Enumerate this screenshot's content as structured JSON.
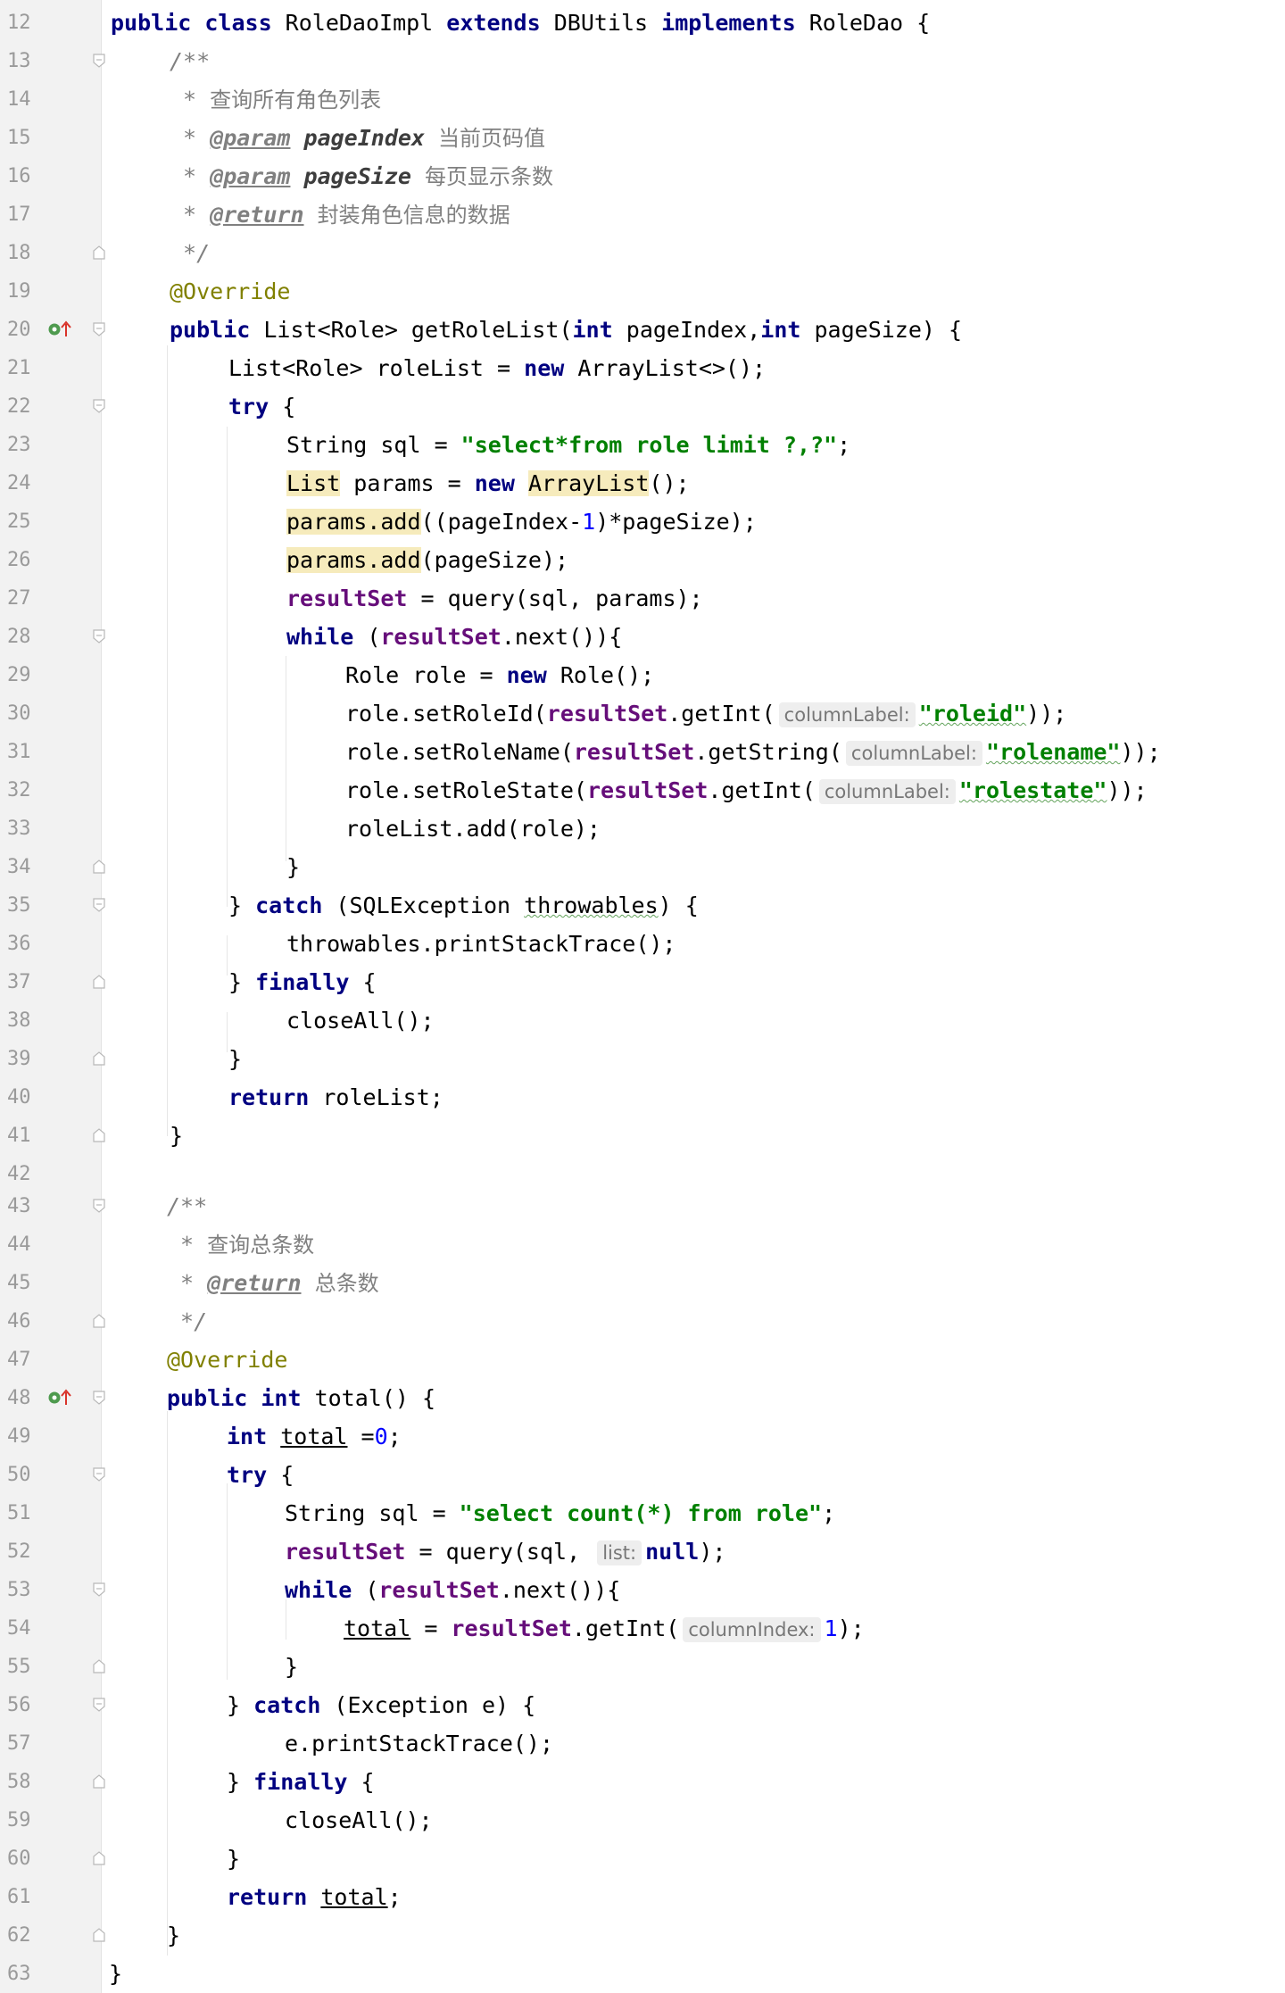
{
  "editor": {
    "theme_colors": {
      "keyword": "#000080",
      "string": "#008000",
      "comment": "#808080",
      "annotation": "#808000",
      "field": "#660e7a",
      "number": "#0000ff",
      "highlight": "#f6ebbc",
      "gutter_bg": "#f2f2f2",
      "line_number": "#9a9a9a"
    },
    "gutter_icons": {
      "20": "implementing-method-icon",
      "48": "implementing-method-icon"
    },
    "lines": {
      "l12": {
        "num": "12",
        "t1": "public class ",
        "t2": "RoleDaoImpl ",
        "t3": "extends ",
        "t4": "DBUtils ",
        "t5": "implements ",
        "t6": "RoleDao {"
      },
      "l13": {
        "num": "13",
        "t1": "/**"
      },
      "l14": {
        "num": "14",
        "t1": " * ",
        "t2": "查询所有角色列表"
      },
      "l15": {
        "num": "15",
        "t1": " * ",
        "t2": "@param",
        "t3": " pageIndex ",
        "t4": "当前页码值"
      },
      "l16": {
        "num": "16",
        "t1": " * ",
        "t2": "@param",
        "t3": " pageSize ",
        "t4": "每页显示条数"
      },
      "l17": {
        "num": "17",
        "t1": " * ",
        "t2": "@return",
        "t3": " ",
        "t4": "封装角色信息的数据"
      },
      "l18": {
        "num": "18",
        "t1": " */"
      },
      "l19": {
        "num": "19",
        "t1": "@Override"
      },
      "l20": {
        "num": "20",
        "t1": "public ",
        "t2": "List<Role> getRoleList(",
        "t3": "int ",
        "t4": "pageIndex,",
        "t5": "int ",
        "t6": "pageSize) {"
      },
      "l21": {
        "num": "21",
        "t1": "List<Role> roleList = ",
        "t2": "new ",
        "t3": "ArrayList<>();"
      },
      "l22": {
        "num": "22",
        "t1": "try ",
        "t2": "{"
      },
      "l23": {
        "num": "23",
        "t1": "String sql = ",
        "t2": "\"select*from role limit ?,?\"",
        "t3": ";"
      },
      "l24": {
        "num": "24",
        "t1": "List",
        "t2": " params = ",
        "t3": "new ",
        "t4": "ArrayList",
        "t5": "();"
      },
      "l25": {
        "num": "25",
        "t1": "params.add",
        "t2": "((pageIndex-",
        "t3": "1",
        "t4": ")*pageSize);"
      },
      "l26": {
        "num": "26",
        "t1": "params.add",
        "t2": "(pageSize);"
      },
      "l27": {
        "num": "27",
        "t1": "resultSet",
        "t2": " = query(sql, params);"
      },
      "l28": {
        "num": "28",
        "t1": "while ",
        "t2": "(",
        "t3": "resultSet",
        "t4": ".next()){"
      },
      "l29": {
        "num": "29",
        "t1": "Role role = ",
        "t2": "new ",
        "t3": "Role();"
      },
      "l30": {
        "num": "30",
        "t1": "role.setRoleId(",
        "t2": "resultSet",
        "t3": ".getInt(",
        "t4": "columnLabel:",
        "t5": "\"roleid\"",
        "t6": "));"
      },
      "l31": {
        "num": "31",
        "t1": "role.setRoleName(",
        "t2": "resultSet",
        "t3": ".getString(",
        "t4": "columnLabel:",
        "t5": "\"rolename\"",
        "t6": "));"
      },
      "l32": {
        "num": "32",
        "t1": "role.setRoleState(",
        "t2": "resultSet",
        "t3": ".getInt(",
        "t4": "columnLabel:",
        "t5": "\"rolestate\"",
        "t6": "));"
      },
      "l33": {
        "num": "33",
        "t1": "roleList.add(role);"
      },
      "l34": {
        "num": "34",
        "t1": "}"
      },
      "l35": {
        "num": "35",
        "t1": "} ",
        "t2": "catch ",
        "t3": "(SQLException ",
        "t4": "throwables",
        "t5": ") {"
      },
      "l36": {
        "num": "36",
        "t1": "throwables.printStackTrace();"
      },
      "l37": {
        "num": "37",
        "t1": "} ",
        "t2": "finally ",
        "t3": "{"
      },
      "l38": {
        "num": "38",
        "t1": "closeAll();"
      },
      "l39": {
        "num": "39",
        "t1": "}"
      },
      "l40": {
        "num": "40",
        "t1": "return ",
        "t2": "roleList;"
      },
      "l41": {
        "num": "41",
        "t1": "}"
      },
      "l42": {
        "num": "42"
      },
      "l43": {
        "num": "43",
        "t1": "/**"
      },
      "l44": {
        "num": "44",
        "t1": " * ",
        "t2": "查询总条数"
      },
      "l45": {
        "num": "45",
        "t1": " * ",
        "t2": "@return",
        "t3": " ",
        "t4": "总条数"
      },
      "l46": {
        "num": "46",
        "t1": " */"
      },
      "l47": {
        "num": "47",
        "t1": "@Override"
      },
      "l48": {
        "num": "48",
        "t1": "public ",
        "t2": "int ",
        "t3": "total() {"
      },
      "l49": {
        "num": "49",
        "t1": "int ",
        "t2": "total",
        "t3": " =",
        "t4": "0",
        "t5": ";"
      },
      "l50": {
        "num": "50",
        "t1": "try ",
        "t2": "{"
      },
      "l51": {
        "num": "51",
        "t1": "String sql = ",
        "t2": "\"select count(*) from role\"",
        "t3": ";"
      },
      "l52": {
        "num": "52",
        "t1": "resultSet",
        "t2": " = query(sql, ",
        "t3": "list:",
        "t4": "null",
        "t5": ");"
      },
      "l53": {
        "num": "53",
        "t1": "while ",
        "t2": "(",
        "t3": "resultSet",
        "t4": ".next()){"
      },
      "l54": {
        "num": "54",
        "t1": "total",
        "t2": " = ",
        "t3": "resultSet",
        "t4": ".getInt(",
        "t5": "columnIndex:",
        "t6": "1",
        "t7": ");"
      },
      "l55": {
        "num": "55",
        "t1": "}"
      },
      "l56": {
        "num": "56",
        "t1": "} ",
        "t2": "catch ",
        "t3": "(Exception e) {"
      },
      "l57": {
        "num": "57",
        "t1": "e.printStackTrace();"
      },
      "l58": {
        "num": "58",
        "t1": "} ",
        "t2": "finally ",
        "t3": "{"
      },
      "l59": {
        "num": "59",
        "t1": "closeAll();"
      },
      "l60": {
        "num": "60",
        "t1": "}"
      },
      "l61": {
        "num": "61",
        "t1": "return ",
        "t2": "total",
        "t3": ";"
      },
      "l62": {
        "num": "62",
        "t1": "}"
      },
      "l63": {
        "num": "63",
        "t1": "}"
      }
    }
  }
}
